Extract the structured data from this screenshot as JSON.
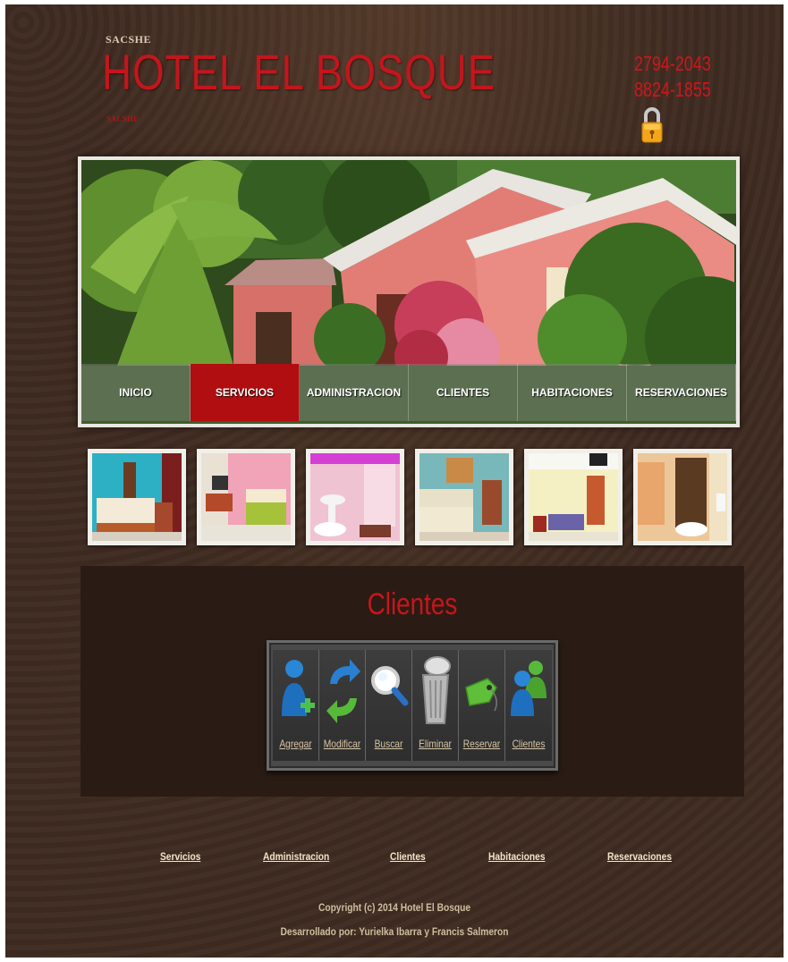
{
  "header": {
    "brand_small": "SACSHE",
    "title": "HOTEL EL BOSQUE",
    "brand_sub": "SACSHE",
    "phone1": "2794-2043",
    "phone2": "8824-1855",
    "lock_icon": "padlock-icon"
  },
  "nav": {
    "items": [
      "INICIO",
      "SERVICIOS",
      "ADMINISTRACION",
      "CLIENTES",
      "HABITACIONES",
      "RESERVACIONES"
    ],
    "active": "SERVICIOS"
  },
  "clients": {
    "title": "Clientes",
    "tools": [
      {
        "label": "Agregar",
        "icon": "add-user-icon"
      },
      {
        "label": "Modificar",
        "icon": "refresh-arrows-icon"
      },
      {
        "label": "Buscar",
        "icon": "magnifier-icon"
      },
      {
        "label": "Eliminar",
        "icon": "trash-can-icon"
      },
      {
        "label": "Reservar",
        "icon": "tag-icon"
      },
      {
        "label": "Clientes",
        "icon": "users-icon"
      }
    ]
  },
  "footer": {
    "links": [
      "Servicios",
      "Administracion",
      "Clientes",
      "Habitaciones",
      "Reservaciones"
    ],
    "copyright": "Copyright (c) 2014 Hotel El Bosque",
    "developers": "Desarrollado por: Yurielka Ibarra y Francis Salmeron"
  },
  "colors": {
    "brand_red": "#c2161d",
    "nav_active": "#b10e11",
    "background": "#3e2a20",
    "panel": "#2a1c15"
  }
}
